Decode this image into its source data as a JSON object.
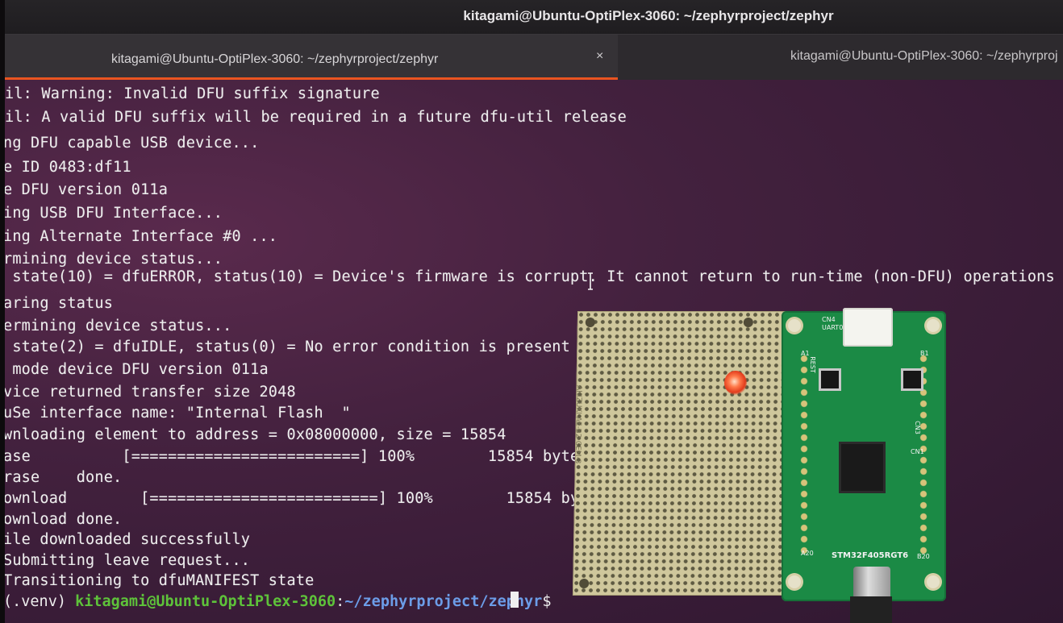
{
  "window": {
    "title": "kitagami@Ubuntu-OptiPlex-3060: ~/zephyrproject/zephyr"
  },
  "tabs": [
    {
      "label": "kitagami@Ubuntu-OptiPlex-3060: ~/zephyrproject/zephyr",
      "active": true,
      "close_glyph": "×"
    },
    {
      "label": "kitagami@Ubuntu-OptiPlex-3060: ~/zephyrproj",
      "active": false
    }
  ],
  "terminal": {
    "lines": [
      "il: Warning: Invalid DFU suffix signature",
      "il: A valid DFU suffix will be required in a future dfu-util release",
      "ng DFU capable USB device...",
      "e ID 0483:df11",
      "e DFU version 011a",
      "ing USB DFU Interface...",
      "ing Alternate Interface #0 ...",
      "rmining device status...",
      " state(10) = dfuERROR, status(10) = Device's firmware is corrupt. It cannot return to run-time (non-DFU) operations",
      "aring status",
      "ermining device status...",
      " state(2) = dfuIDLE, status(0) = No error condition is present",
      " mode device DFU version 011a",
      "vice returned transfer size 2048",
      "uSe interface name: \"Internal Flash  \"",
      "wnloading element to address = 0x08000000, size = 15854",
      "ase          [=========================] 100%        15854 bytes",
      "rase    done.",
      "ownload        [=========================] 100%        15854 bytes",
      "ownload done.",
      "ile downloaded successfully",
      "Submitting leave request...",
      "Transitioning to dfuMANIFEST state"
    ],
    "prompt": {
      "venv": "(.venv) ",
      "user_host": "kitagami@Ubuntu-OptiPlex-3060",
      "colon": ":",
      "path": "~/zephyrproject/zephyr",
      "dollar": "$ "
    }
  },
  "photo": {
    "perfboard_label": "AKIZUKI  AE-B2-CEM-3",
    "pcb_labels": {
      "cn4": "CN4",
      "uart0": "UART0",
      "rest": "REST",
      "board_name": "STM32F405RGT6",
      "a1": "A1",
      "b1": "B1",
      "a20": "A20",
      "b20": "B20",
      "cn1": "CN1",
      "cn3": "CN3"
    }
  },
  "colors": {
    "accent_tab_underline": "#e95420",
    "prompt_user": "#5ec23a",
    "prompt_path": "#6c9de8",
    "terminal_bg": "#43213e"
  }
}
